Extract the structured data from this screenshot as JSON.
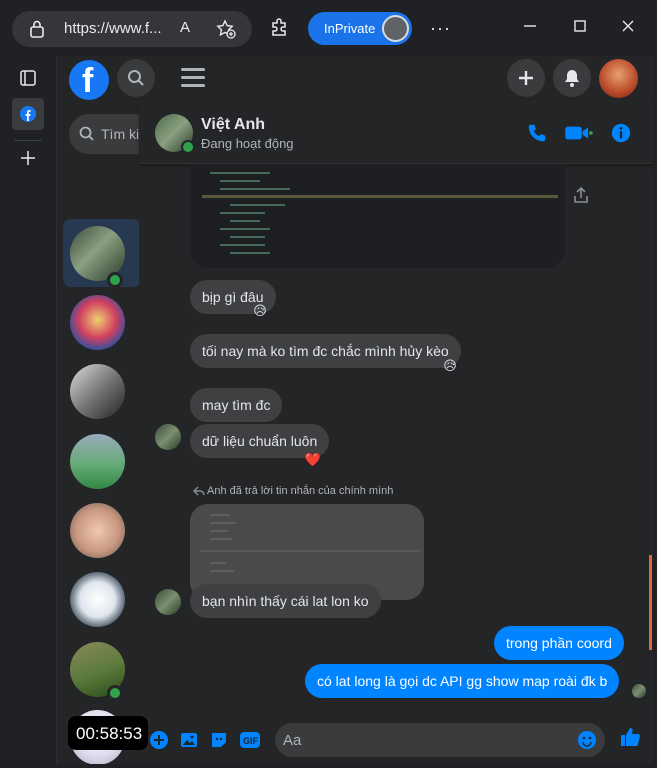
{
  "browser": {
    "url": "https://www.f...",
    "read_aloud_label": "A",
    "inprivate_label": "InPrivate",
    "more_label": "···"
  },
  "fb": {
    "search_placeholder": "Tìm ki"
  },
  "chat": {
    "contact_name": "Việt Anh",
    "contact_status": "Đang hoạt động",
    "messages": [
      {
        "text": "bịp gì đâu",
        "reaction": "😥"
      },
      {
        "text": "tối nay mà ko tìm đc chắc mình hủy kèo",
        "reaction": "😥"
      },
      {
        "text": "may tìm đc"
      },
      {
        "text": "dữ liệu chuẩn luôn",
        "reaction": "❤️"
      },
      {
        "text": "bạn nhìn thấy cái lat lon ko"
      },
      {
        "text": "trong phần coord"
      },
      {
        "text": "có lat long là gọi dc API gg show map roài đk b"
      }
    ],
    "reply_note": "Anh đã trả lời tin nhắn của chính mình",
    "composer_placeholder": "Aa"
  },
  "overlay": {
    "timer": "00:58:53"
  },
  "colors": {
    "accent": "#0084ff",
    "brand": "#1877f2",
    "online": "#31a24c"
  }
}
